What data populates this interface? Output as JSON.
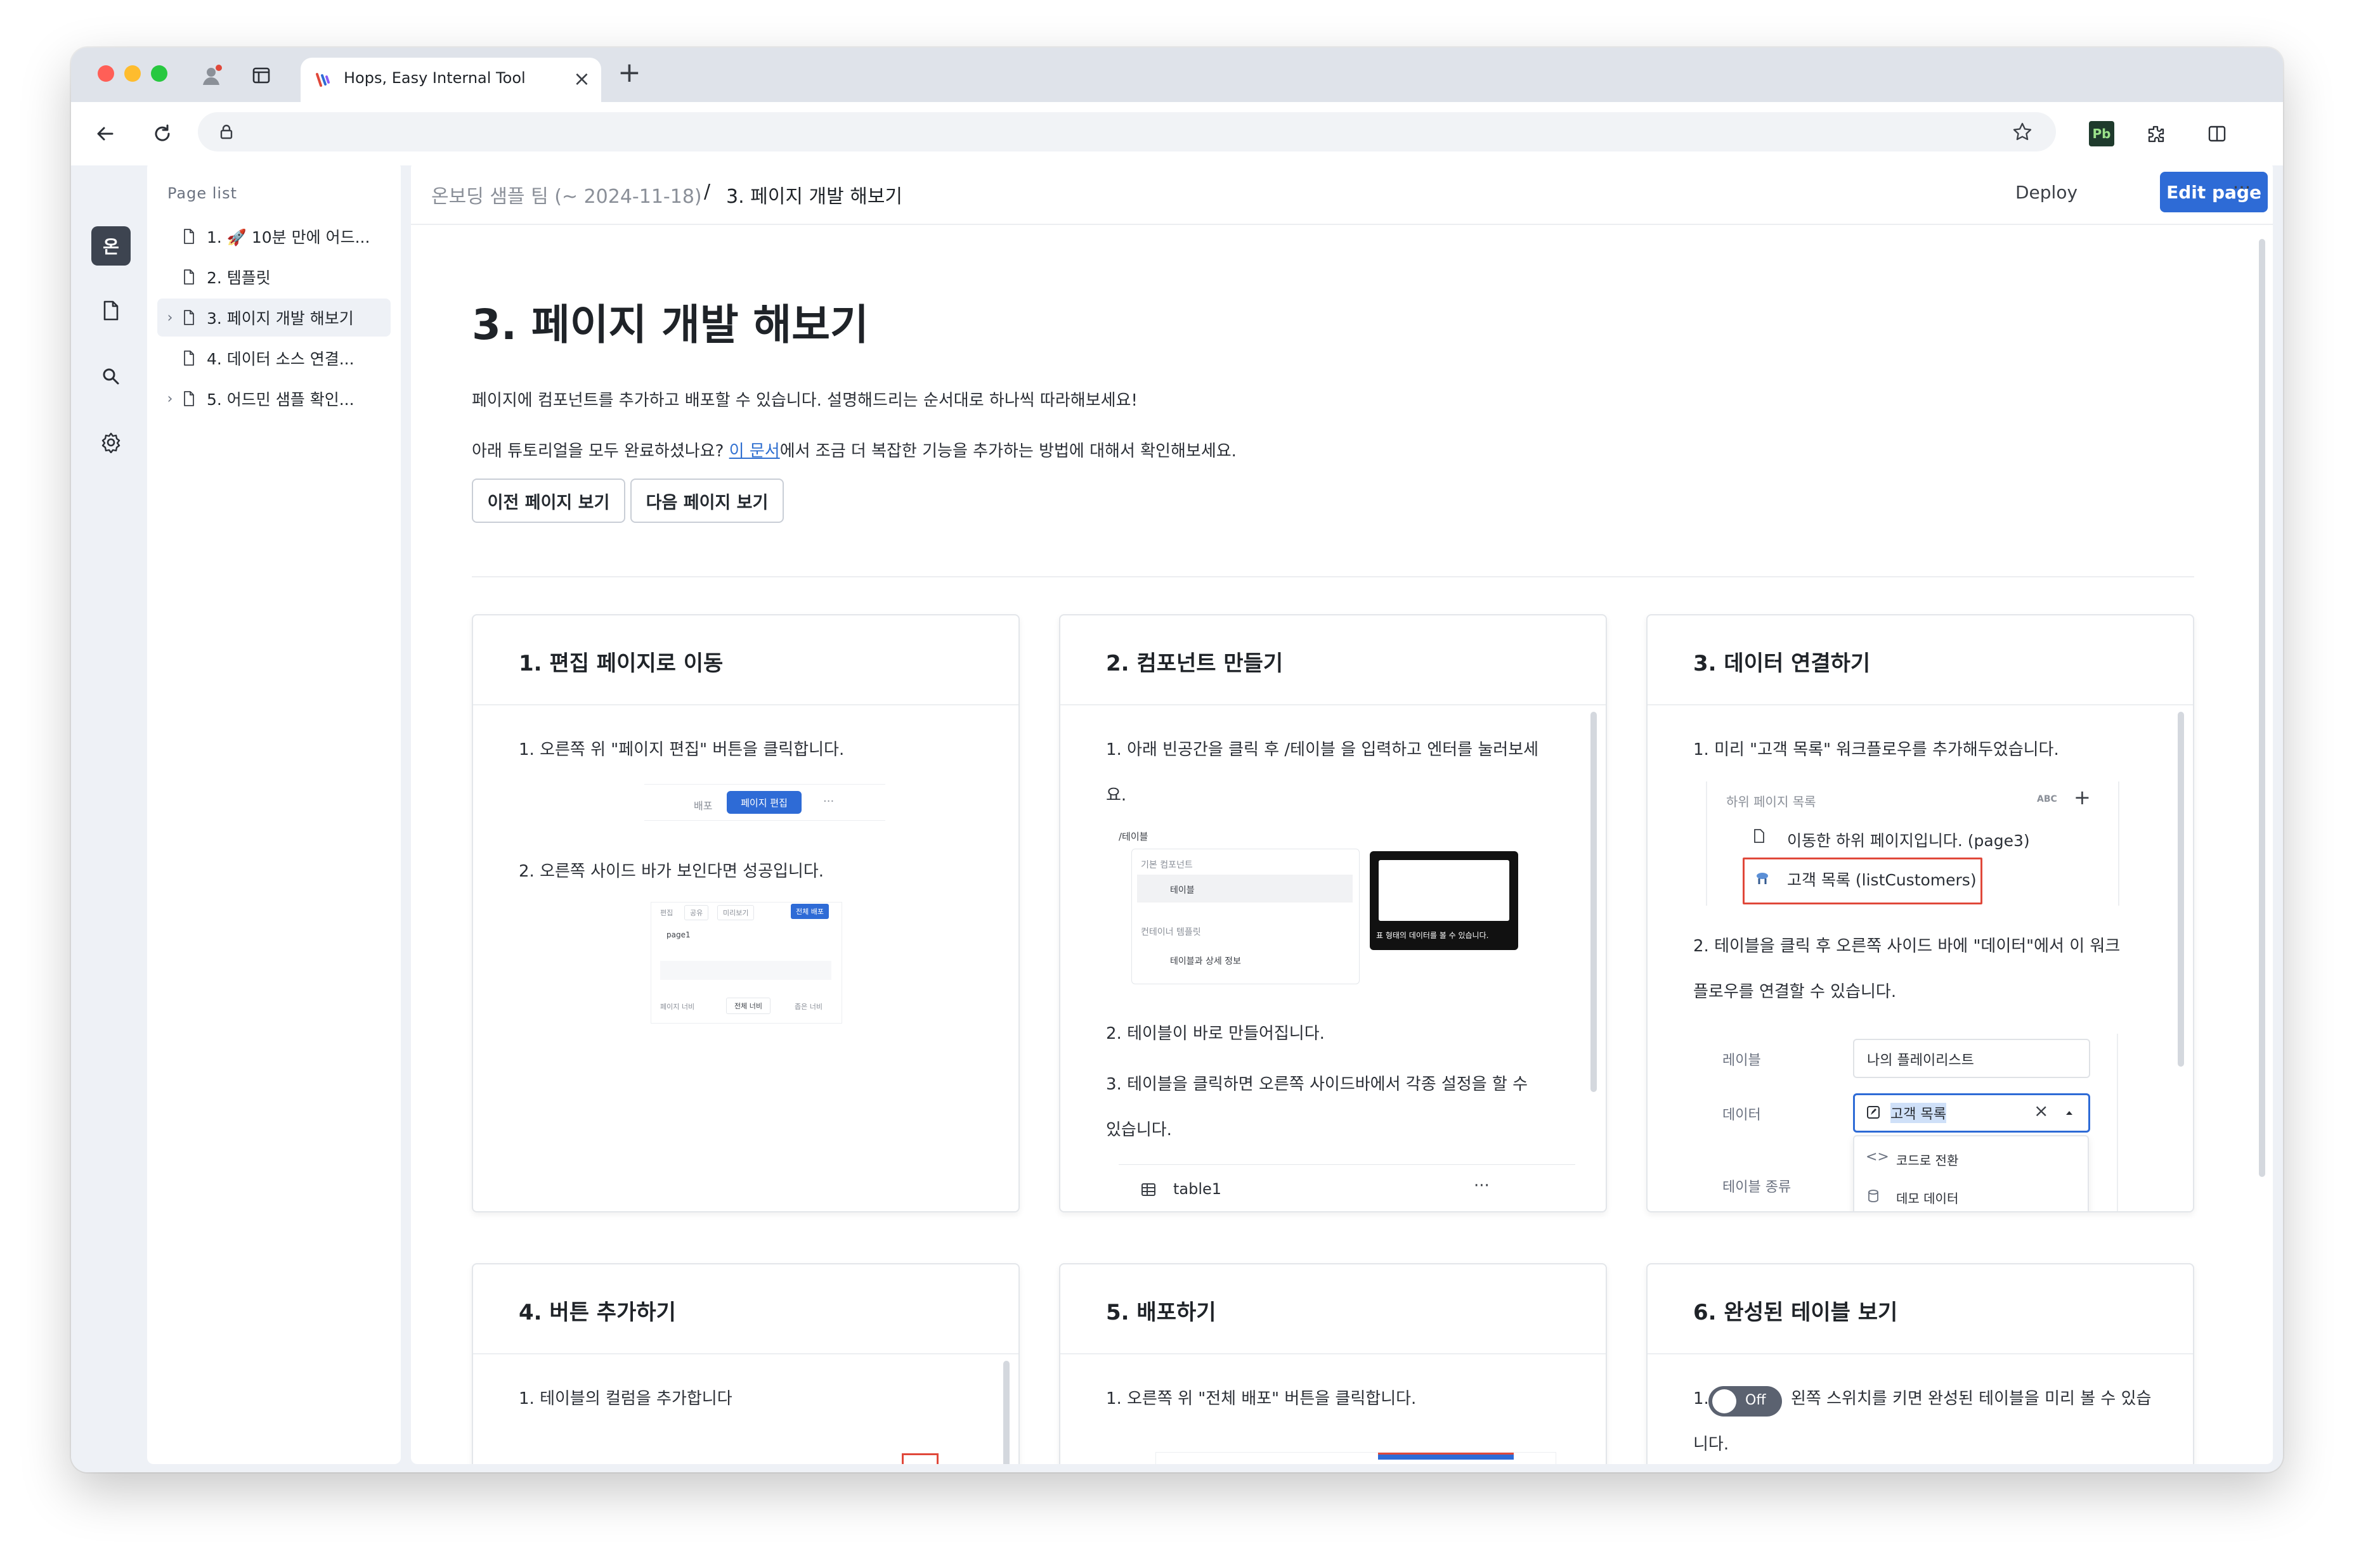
{
  "browser": {
    "tab_title": "Hops, Easy Internal Tool",
    "new_tab_symbol": "+",
    "close_symbol": "×",
    "extension_label": "Pb"
  },
  "rail": {
    "workspace_initial": "온"
  },
  "page_list": {
    "heading": "Page list",
    "items": [
      {
        "label": "1. 🚀 10분 만에 어드...",
        "has_children": false
      },
      {
        "label": "2. 템플릿",
        "has_children": false
      },
      {
        "label": "3. 페이지 개발 해보기",
        "has_children": true,
        "active": true
      },
      {
        "label": "4. 데이터 소스 연결...",
        "has_children": false
      },
      {
        "label": "5. 어드민 샘플 확인...",
        "has_children": true
      }
    ]
  },
  "header": {
    "breadcrumb_parent": "온보딩 샘플 팀 (~ 2024-11-18)",
    "breadcrumb_sep": "/",
    "breadcrumb_current": "3. 페이지 개발 해보기",
    "deploy_label": "Deploy",
    "edit_label": "Edit page",
    "more_label": "···"
  },
  "content": {
    "title": "3. 페이지 개발 해보기",
    "intro": "페이지에 컴포넌트를 추가하고 배포할 수 있습니다. 설명해드리는 순서대로 하나씩 따라해보세요!",
    "line2_pre": "아래 튜토리얼을 모두 완료하셨나요? ",
    "line2_link": "이 문서",
    "line2_post": "에서 조금 더 복잡한 기능을 추가하는 방법에 대해서 확인해보세요.",
    "prev_button": "이전 페이지 보기",
    "next_button": "다음 페이지 보기"
  },
  "cards": {
    "c1": {
      "title": "1. 편집 페이지로 이동",
      "step1": "1. 오른쪽 위 \"페이지 편집\" 버튼을 클릭합니다.",
      "step2": "2. 오른쪽 사이드 바가 보인다면 성공입니다.",
      "mock1": {
        "deploy": "배포",
        "edit": "페이지 편집",
        "more": "···"
      },
      "mock2": {
        "t1": "편집",
        "t2": "공유",
        "t3": "미리보기",
        "t4": "전체 배포",
        "page": "page1",
        "r1": "페이지 너비",
        "r2": "전체 너비",
        "r3": "좁은 너비"
      }
    },
    "c2": {
      "title": "2. 컴포넌트 만들기",
      "step1a": "1. 아래 빈공간을 클릭 후 /테이블 을 입력하고 엔터를 눌러보세",
      "step1b": "요.",
      "step2": "2. 테이블이 바로 만들어집니다.",
      "step3a": "3. 테이블을 클릭하면 오른쪽 사이드바에서 각종 설정을 할 수",
      "step3b": "있습니다.",
      "mock": {
        "cmd": "/테이블",
        "sec1": "기본 컴포넌트",
        "item1": "테이블",
        "sec2": "컨테이너 템플릿",
        "item2": "테이블과 상세 정보",
        "preview_caption": "표 형태의 데이터를 볼 수 있습니다."
      },
      "table_name": "table1",
      "table_more": "···"
    },
    "c3": {
      "title": "3. 데이터 연결하기",
      "step1": "1. 미리 \"고객 목록\" 워크플로우를 추가해두었습니다.",
      "step2a": "2. 테이블을 클릭 후 오른쪽 사이드 바에 \"데이터\"에서 이 워크",
      "step2b": "플로우를 연결할 수 있습니다.",
      "mock1": {
        "section": "하위 페이지 목록",
        "abc": "ABC",
        "plus": "+",
        "sub": "이동한 하위 페이지입니다. (page3)",
        "workflow": "고객 목록 (listCustomers)"
      },
      "mock2": {
        "label_label": "레이블",
        "label_value": "나의 플레이리스트",
        "data_label": "데이터",
        "data_value": "고객 목록",
        "kind_label": "테이블 종류",
        "opt1": "코드로 전환",
        "opt2": "데모 데이터"
      }
    },
    "c4": {
      "title": "4. 버튼 추가하기",
      "step1": "1. 테이블의 컬럼을 추가합니다"
    },
    "c5": {
      "title": "5. 배포하기",
      "step1": "1. 오른쪽 위 \"전체 배포\" 버튼을 클릭합니다."
    },
    "c6": {
      "title": "6. 완성된 테이블 보기",
      "num": "1.",
      "toggle": "Off",
      "step1": "왼쪽 스위치를 키면 완성된 테이블을 미리 볼 수 있습",
      "step1b": "니다."
    }
  },
  "colors": {
    "accent": "#2e6bd6",
    "link": "#2f6fd0",
    "highlight_red": "#e0483a",
    "traffic_red": "#ff5f57",
    "traffic_yellow": "#febc2e",
    "traffic_green": "#28c840"
  }
}
